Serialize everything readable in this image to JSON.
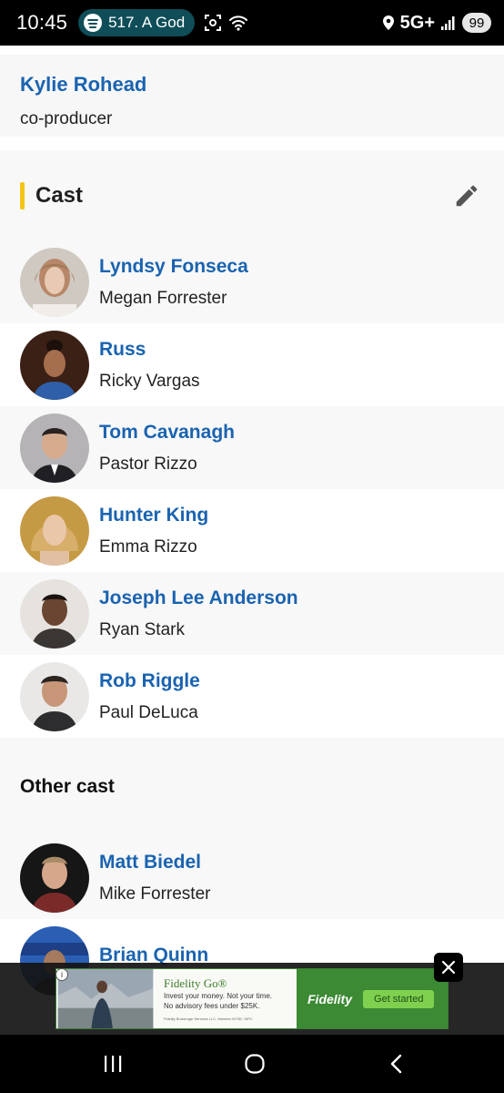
{
  "status_bar": {
    "time": "10:45",
    "media_text": "517. A Godl",
    "network": "5G+",
    "battery": "99"
  },
  "crew": {
    "name": "Kylie Rohead",
    "job": "co-producer"
  },
  "cast": {
    "title": "Cast",
    "accent_color": "#f5c518",
    "members": [
      {
        "name": "Lyndsy Fonseca",
        "role": "Megan Forrester"
      },
      {
        "name": "Russ",
        "role": "Ricky Vargas"
      },
      {
        "name": "Tom Cavanagh",
        "role": "Pastor Rizzo"
      },
      {
        "name": "Hunter King",
        "role": "Emma Rizzo"
      },
      {
        "name": "Joseph Lee Anderson",
        "role": "Ryan Stark"
      },
      {
        "name": "Rob Riggle",
        "role": "Paul DeLuca"
      }
    ]
  },
  "other_cast": {
    "title": "Other cast",
    "members": [
      {
        "name": "Matt Biedel",
        "role": "Mike Forrester"
      },
      {
        "name": "Brian Quinn",
        "role": ""
      }
    ]
  },
  "ad": {
    "title": "Fidelity Go®",
    "line1": "Invest your money. Not your time.",
    "line2": "No advisory fees under $25K.",
    "fine_print": "Fidelity Brokerage Services LLC, Member NYSE, SIPC",
    "brand": "Fidelity",
    "cta": "Get started",
    "info": "i"
  },
  "link_color": "#1a63b0"
}
